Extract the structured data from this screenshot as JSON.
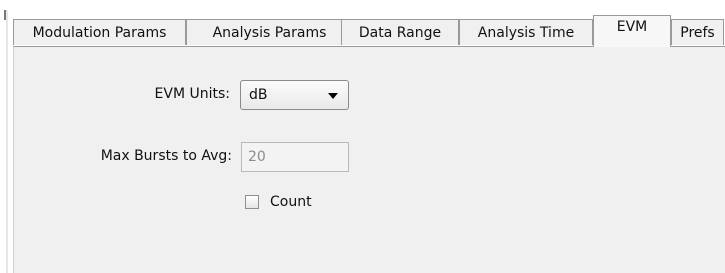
{
  "tabs": [
    {
      "label": "Modulation Params",
      "active": false
    },
    {
      "label": "Analysis Params",
      "active": false
    },
    {
      "label": "Data Range",
      "active": false
    },
    {
      "label": "Analysis Time",
      "active": false
    },
    {
      "label": "EVM",
      "active": true
    },
    {
      "label": "Prefs",
      "active": false
    }
  ],
  "form": {
    "evm_units_label": "EVM Units:",
    "evm_units_value": "dB",
    "max_bursts_label": "Max Bursts to Avg:",
    "max_bursts_value": "20",
    "max_bursts_enabled": false,
    "count_label": "Count",
    "count_checked": false
  },
  "icons": {
    "dropdown": "chevron-down-icon",
    "checkbox": "checkbox-unchecked"
  },
  "colors": {
    "panel_bg": "#f0f0f0",
    "active_tab_bg": "#f7f7f7",
    "tab_border": "#9a9a9a",
    "disabled_text": "#8c8c8c"
  }
}
